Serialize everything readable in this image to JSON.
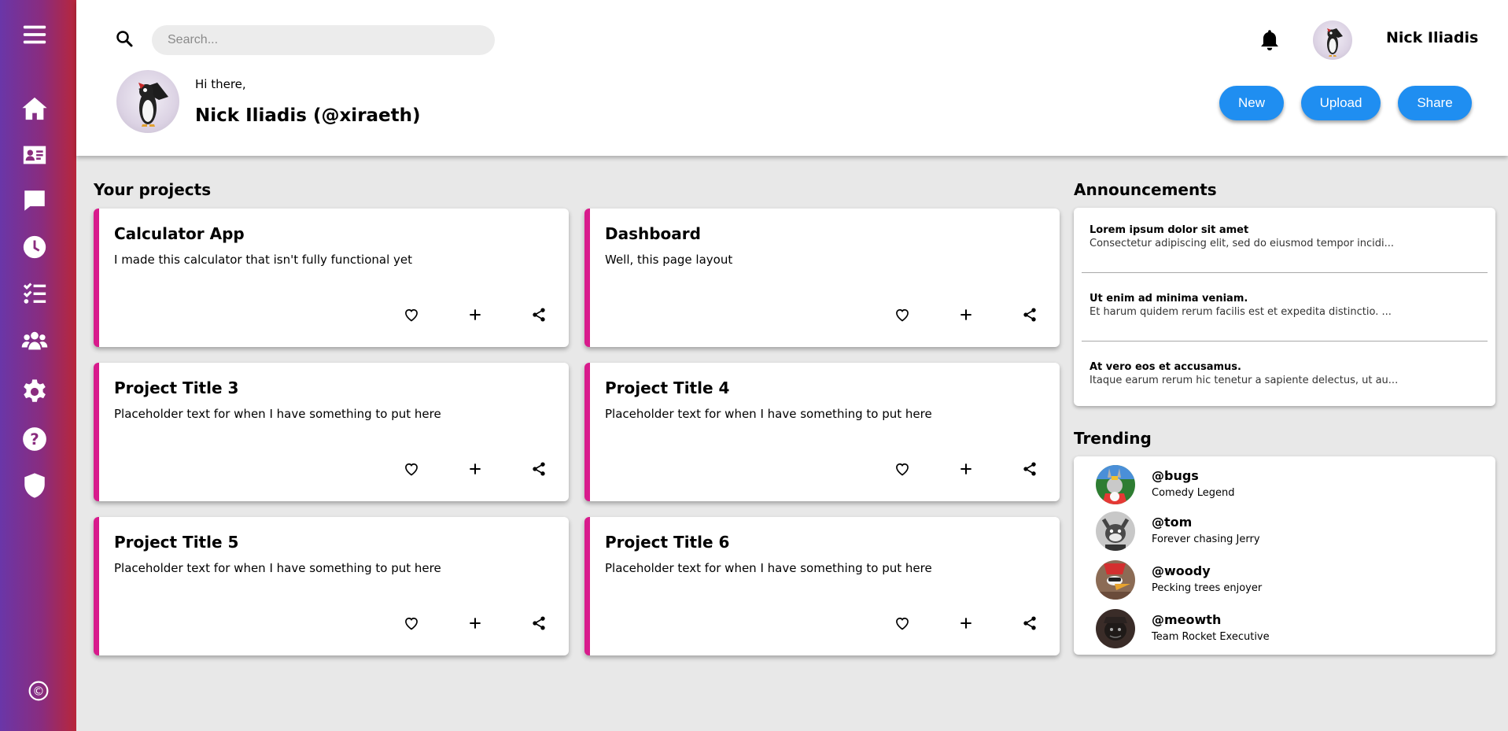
{
  "sidebar": {
    "items": [
      {
        "icon": "menu-icon"
      },
      {
        "icon": "home-icon"
      },
      {
        "icon": "id-card-icon"
      },
      {
        "icon": "chat-icon"
      },
      {
        "icon": "clock-icon"
      },
      {
        "icon": "tasks-icon"
      },
      {
        "icon": "users-icon"
      },
      {
        "icon": "gear-icon"
      },
      {
        "icon": "help-icon"
      },
      {
        "icon": "shield-icon"
      }
    ],
    "footer": "©"
  },
  "header": {
    "search_placeholder": "Search...",
    "user_name": "Nick Iliadis",
    "greeting": "Hi there,",
    "full_name": "Nick Iliadis (@xiraeth)",
    "buttons": {
      "new": "New",
      "upload": "Upload",
      "share": "Share"
    }
  },
  "projects": {
    "title": "Your projects",
    "items": [
      {
        "title": "Calculator App",
        "desc": "I made this calculator that isn't fully functional yet"
      },
      {
        "title": "Dashboard",
        "desc": "Well, this page layout"
      },
      {
        "title": "Project Title 3",
        "desc": "Placeholder text for when I have something to put here"
      },
      {
        "title": "Project Title 4",
        "desc": "Placeholder text for when I have something to put here"
      },
      {
        "title": "Project Title 5",
        "desc": "Placeholder text for when I have something to put here"
      },
      {
        "title": "Project Title 6",
        "desc": "Placeholder text for when I have something to put here"
      }
    ]
  },
  "announcements": {
    "title": "Announcements",
    "items": [
      {
        "title": "Lorem ipsum dolor sit amet",
        "text": "Consectetur adipiscing elit, sed do eiusmod tempor incidi..."
      },
      {
        "title": "Ut enim ad minima veniam.",
        "text": "Et harum quidem rerum facilis est et expedita distinctio. ..."
      },
      {
        "title": "At vero eos et accusamus.",
        "text": "Itaque earum rerum hic tenetur a sapiente delectus, ut au..."
      }
    ]
  },
  "trending": {
    "title": "Trending",
    "items": [
      {
        "handle": "@bugs",
        "desc": "Comedy Legend"
      },
      {
        "handle": "@tom",
        "desc": "Forever chasing Jerry"
      },
      {
        "handle": "@woody",
        "desc": "Pecking trees enjoyer"
      },
      {
        "handle": "@meowth",
        "desc": "Team Rocket Executive"
      }
    ]
  },
  "colors": {
    "accent": "#1f8ef1",
    "card_border": "#d81b8c",
    "sidebar_start": "#6a36a8",
    "sidebar_end": "#b8263a"
  }
}
